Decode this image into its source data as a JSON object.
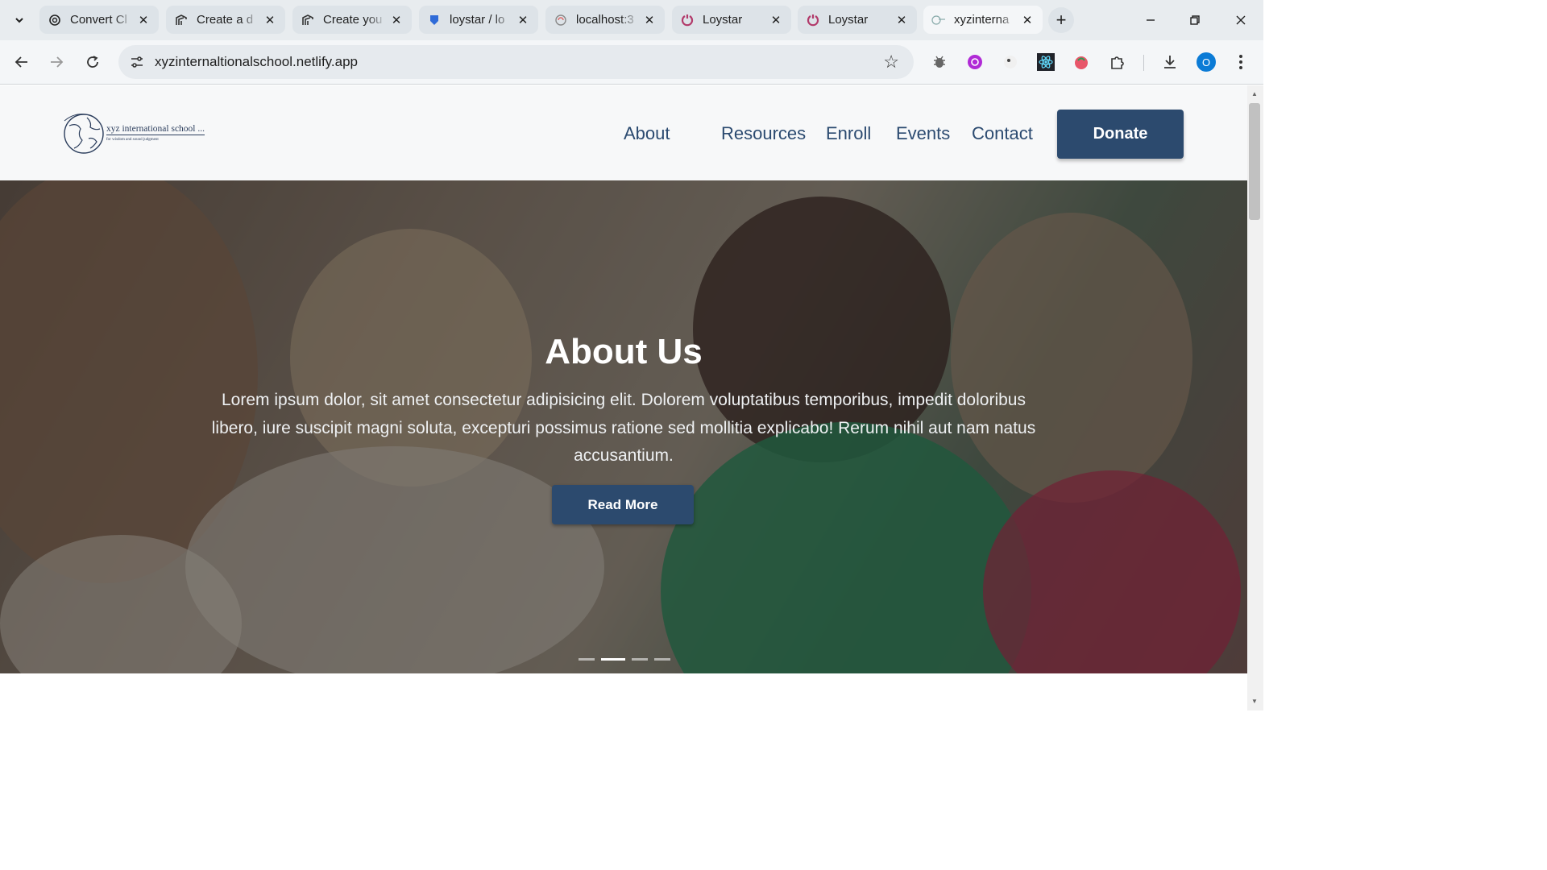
{
  "browser": {
    "tabs": [
      {
        "title": "Convert Cl",
        "icon": "openai-icon",
        "active": false
      },
      {
        "title": "Create a d",
        "icon": "github-icon",
        "active": false
      },
      {
        "title": "Create you",
        "icon": "github-icon",
        "active": false
      },
      {
        "title": "loystar / lo",
        "icon": "shield-icon",
        "active": false
      },
      {
        "title": "localhost:3",
        "icon": "globe-icon",
        "active": false
      },
      {
        "title": "Loystar",
        "icon": "loystar-icon",
        "active": false
      },
      {
        "title": "Loystar",
        "icon": "loystar-icon",
        "active": false
      },
      {
        "title": "xyzinterna",
        "icon": "school-logo-icon",
        "active": true
      }
    ],
    "url": "xyzinternaltionalschool.netlify.app",
    "profile_initial": "O",
    "colors": {
      "tabstrip": "#e8ecef",
      "toolbar": "#f4f6f8",
      "profile": "#0b7bd6"
    }
  },
  "site": {
    "logo": {
      "name": "xyz international school ...",
      "tagline": "for wisdom and sound judgment"
    },
    "nav": {
      "about": "About",
      "resources": "Resources",
      "enroll": "Enroll",
      "events": "Events",
      "contact": "Contact"
    },
    "donate_label": "Donate",
    "hero": {
      "title": "About Us",
      "text": "Lorem ipsum dolor, sit amet consectetur adipisicing elit. Dolorem voluptatibus temporibus, impedit doloribus libero, iure suscipit magni soluta, excepturi possimus ratione sed mollitia explicabo! Rerum nihil aut nam natus accusantium.",
      "button": "Read More",
      "slides": 4,
      "active_slide": 2
    },
    "colors": {
      "primary": "#2c4a6e",
      "nav_text": "#2b4a70"
    }
  }
}
